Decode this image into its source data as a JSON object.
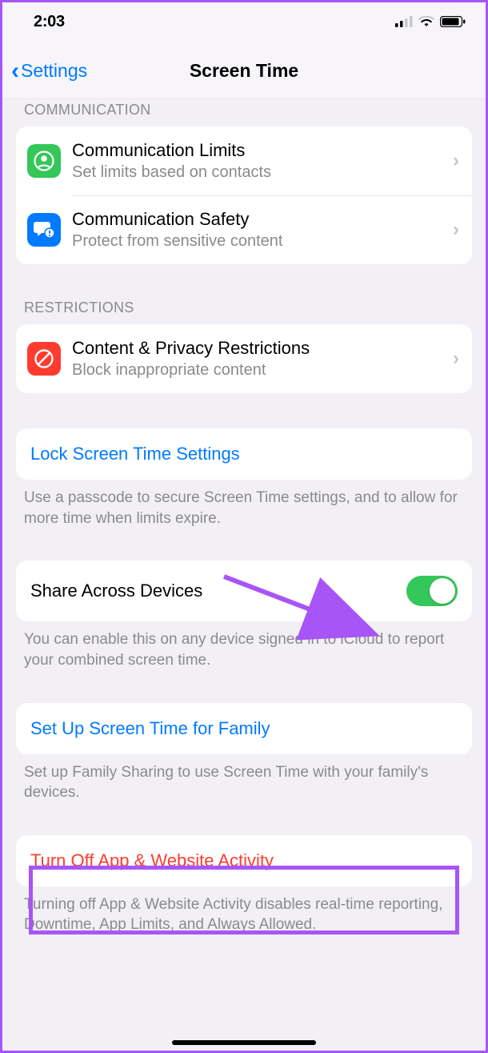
{
  "status": {
    "time": "2:03"
  },
  "nav": {
    "back_label": "Settings",
    "title": "Screen Time"
  },
  "sections": {
    "communication_header": "COMMUNICATION",
    "comm_limits": {
      "title": "Communication Limits",
      "subtitle": "Set limits based on contacts"
    },
    "comm_safety": {
      "title": "Communication Safety",
      "subtitle": "Protect from sensitive content"
    },
    "restrictions_header": "RESTRICTIONS",
    "content_privacy": {
      "title": "Content & Privacy Restrictions",
      "subtitle": "Block inappropriate content"
    },
    "lock": {
      "label": "Lock Screen Time Settings"
    },
    "lock_help": "Use a passcode to secure Screen Time settings, and to allow for more time when limits expire.",
    "share": {
      "label": "Share Across Devices",
      "on": true
    },
    "share_help": "You can enable this on any device signed in to iCloud to report your combined screen time.",
    "family": {
      "label": "Set Up Screen Time for Family"
    },
    "family_help": "Set up Family Sharing to use Screen Time with your family's devices.",
    "turn_off": {
      "label": "Turn Off App & Website Activity"
    },
    "turn_off_help": "Turning off App & Website Activity disables real-time reporting, Downtime, App Limits, and Always Allowed."
  },
  "colors": {
    "accent_blue": "#007aff",
    "green": "#34c759",
    "red": "#ff3b30",
    "annotation_purple": "#a855f7"
  }
}
